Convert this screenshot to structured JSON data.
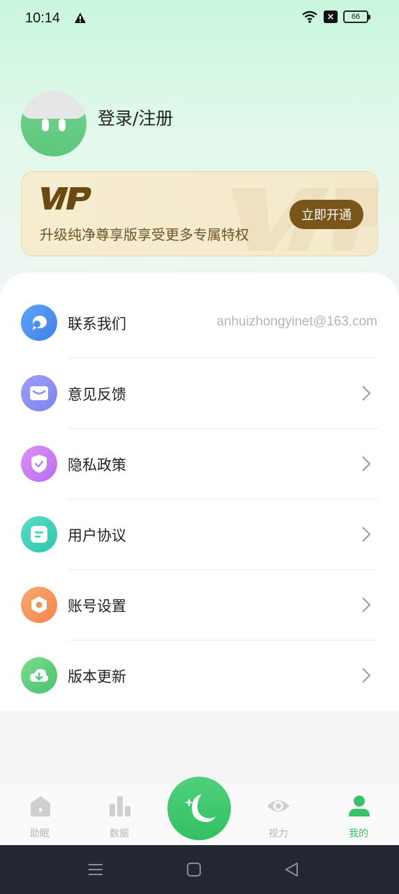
{
  "status_bar": {
    "time": "10:14",
    "battery": "66"
  },
  "profile": {
    "login_label": "登录/注册"
  },
  "vip": {
    "logo_text": "VIP",
    "description": "升级纯净尊享版享受更多专属特权",
    "button_label": "立即开通"
  },
  "menu": {
    "items": [
      {
        "label": "联系我们",
        "value": "anhuizhongyinet@163.com",
        "icon": "chat-bubble-icon",
        "color": "#4a8ff0"
      },
      {
        "label": "意见反馈",
        "icon": "mail-icon",
        "color": "#8a8ff0"
      },
      {
        "label": "隐私政策",
        "icon": "shield-icon",
        "color": "#c77bf0"
      },
      {
        "label": "用户协议",
        "icon": "document-icon",
        "color": "#3fd0b8"
      },
      {
        "label": "账号设置",
        "icon": "settings-icon",
        "color": "#f5925a"
      },
      {
        "label": "版本更新",
        "icon": "download-cloud-icon",
        "color": "#52c97a"
      }
    ]
  },
  "tab_bar": {
    "tabs": [
      {
        "label": "助眠",
        "icon": "home-icon",
        "active": false
      },
      {
        "label": "数据",
        "icon": "bar-chart-icon",
        "active": false
      },
      {
        "label": "视力",
        "icon": "eye-icon",
        "active": false
      },
      {
        "label": "我的",
        "icon": "person-icon",
        "active": true
      }
    ],
    "center_icon": "moon-icon",
    "accent_color": "#39c26a"
  }
}
